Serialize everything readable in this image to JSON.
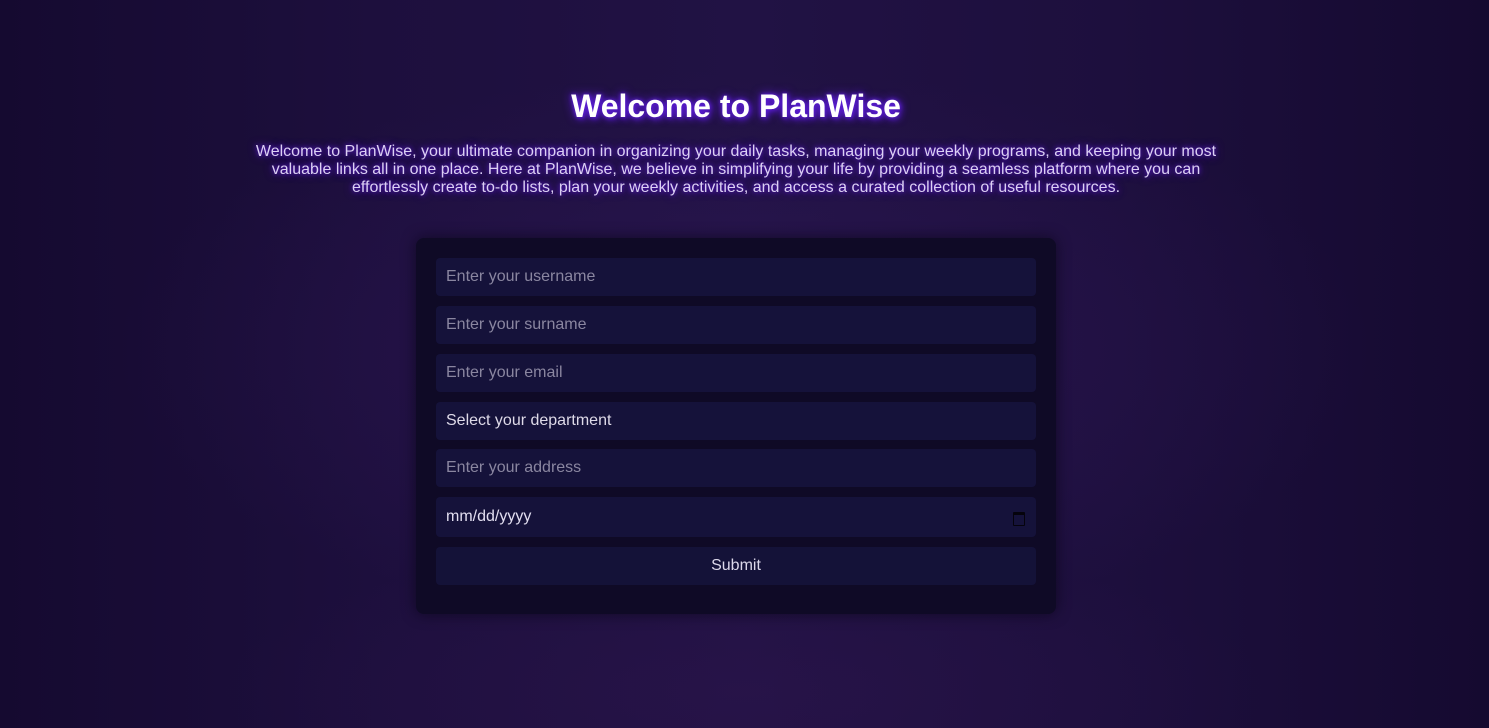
{
  "hero": {
    "title": "Welcome to PlanWise",
    "description": "Welcome to PlanWise, your ultimate companion in organizing your daily tasks, managing your weekly programs, and keeping your most valuable links all in one place. Here at PlanWise, we believe in simplifying your life by providing a seamless platform where you can effortlessly create to-do lists, plan your weekly activities, and access a curated collection of useful resources."
  },
  "form": {
    "username_placeholder": "Enter your username",
    "surname_placeholder": "Enter your surname",
    "email_placeholder": "Enter your email",
    "department_selected": "Select your department",
    "address_placeholder": "Enter your address",
    "date_value": "mm/dd/yyyy",
    "submit_label": "Submit"
  },
  "icons": {
    "calendar": "calendar-icon"
  },
  "colors": {
    "background": "#1d0f3d",
    "card": "#0f0a26",
    "field": "#15123a",
    "title_glow": "#6a22ee"
  }
}
